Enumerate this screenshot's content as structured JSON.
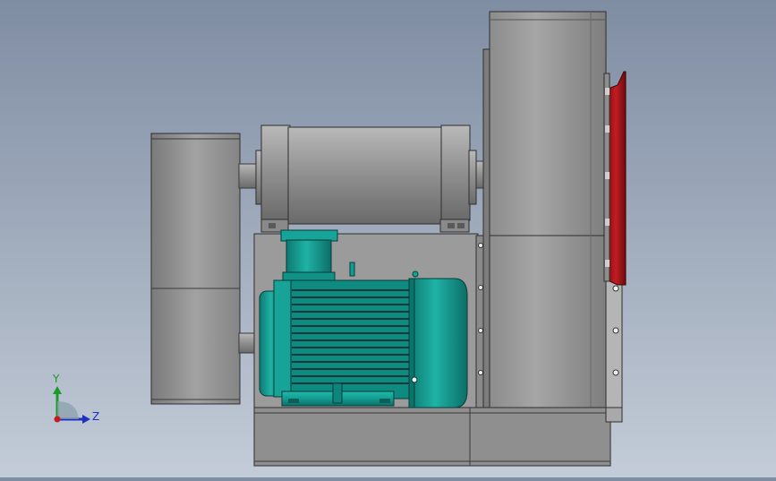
{
  "triad": {
    "y_label": "Y",
    "z_label": "Z",
    "y_color": "#1a9a2a",
    "z_color": "#1f2fbf",
    "origin_color": "#c81a1a"
  },
  "colors": {
    "background_top": "#7f8da3",
    "background_bottom": "#c3ccd8",
    "housing_grey": "#9a9a9a",
    "motor_teal": "#139c92",
    "flange_red": "#b0161a"
  }
}
